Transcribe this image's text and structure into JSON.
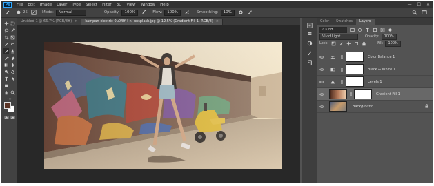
{
  "menu": {
    "logo": "Ps",
    "items": [
      "File",
      "Edit",
      "Image",
      "Layer",
      "Type",
      "Select",
      "Filter",
      "3D",
      "View",
      "Window",
      "Help"
    ]
  },
  "window_controls": {
    "minimize": "—",
    "maximize": "☐",
    "close": "✕"
  },
  "options_bar": {
    "brush_size": "25",
    "mode_label": "Mode:",
    "mode_value": "Normal",
    "opacity_label": "Opacity:",
    "opacity_value": "100%",
    "flow_label": "Flow:",
    "flow_value": "100%",
    "smoothing_label": "Smoothing:",
    "smoothing_value": "10%"
  },
  "document_tabs": [
    {
      "label": "Untitled-1 @ 66.7% (RGB/8#)",
      "active": false
    },
    {
      "label": "kampan-electric-0u0f8f_l-nI-unsplash.jpg @ 12.5% (Gradient Fill 1, RGB/8)",
      "active": true
    }
  ],
  "panel": {
    "tabs": [
      "Color",
      "Swatches",
      "Layers"
    ],
    "active_tab": "Layers",
    "filter_kind": "Kind",
    "blend_mode": "Vivid Light",
    "opacity_label": "Opacity:",
    "opacity_value": "100%",
    "lock_label": "Lock:",
    "fill_label": "Fill:",
    "fill_value": "100%"
  },
  "layers": [
    {
      "name": "Color Balance 1",
      "kind": "adjustment",
      "icon": "balance-icon",
      "selected": false
    },
    {
      "name": "Black & White 1",
      "kind": "adjustment",
      "icon": "bw-icon",
      "selected": false
    },
    {
      "name": "Levels 1",
      "kind": "adjustment",
      "icon": "levels-icon",
      "selected": false
    },
    {
      "name": "Gradient Fill 1",
      "kind": "gradient",
      "icon": "gradient-icon",
      "selected": true
    },
    {
      "name": "Background",
      "kind": "background",
      "icon": "photo-thumbnail",
      "selected": false
    }
  ],
  "colors": {
    "foreground": "#5a3324",
    "background": "#ffffff",
    "ps_blue": "#31a8ff"
  }
}
